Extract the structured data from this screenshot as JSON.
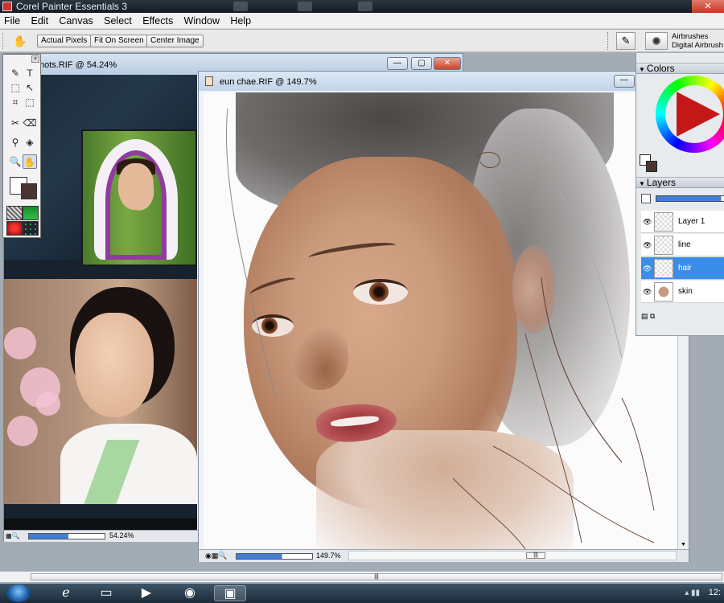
{
  "window": {
    "title": "Corel Painter Essentials 3",
    "close_glyph": "✕"
  },
  "menu": [
    "File",
    "Edit",
    "Canvas",
    "Select",
    "Effects",
    "Window",
    "Help"
  ],
  "propbar": {
    "buttons": [
      "Actual Pixels",
      "Fit On Screen",
      "Center Image"
    ],
    "brush_category": "Airbrushes",
    "brush_variant": "Digital Airbrush"
  },
  "doc_reference": {
    "title": "hots.RIF @ 54.24%",
    "zoom": "54.24%",
    "zoom_fraction": 0.52,
    "buttons": {
      "min": "—",
      "max": "▢",
      "close": "✕"
    }
  },
  "doc_painting": {
    "title": "eun chae.RIF @ 149.7%",
    "zoom": "149.7%",
    "zoom_fraction": 0.6,
    "min_glyph": "—"
  },
  "panels": {
    "colors_title": "Colors",
    "layers_title": "Layers",
    "layers": [
      {
        "name": "Layer 1",
        "selected": false,
        "visible": true
      },
      {
        "name": "line",
        "selected": false,
        "visible": true
      },
      {
        "name": "hair",
        "selected": true,
        "visible": true
      },
      {
        "name": "skin",
        "selected": false,
        "visible": true
      }
    ]
  },
  "toolbox": {
    "tools": [
      "brush-icon",
      "text-icon",
      "rect-select-icon",
      "transform-icon",
      "crop-icon",
      "lasso-icon",
      "cloner-icon",
      "eraser-icon",
      "dropper-icon",
      "bucket-icon",
      "magnifier-icon",
      "grabber-icon"
    ],
    "main_color": "#4a3432",
    "additional_color": "#ffffff"
  },
  "taskbar": {
    "clock": "12:",
    "items": [
      "internet-explorer-icon",
      "explorer-folder-icon",
      "media-player-icon",
      "chrome-icon",
      "painter-icon"
    ]
  }
}
